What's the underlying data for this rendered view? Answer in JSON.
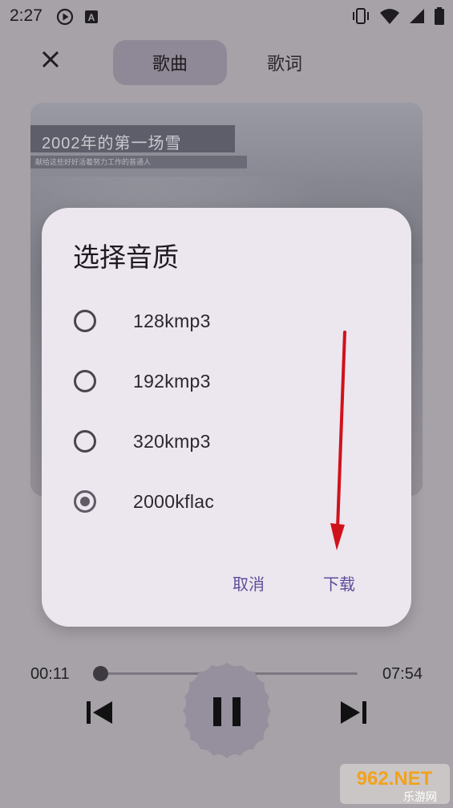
{
  "status_bar": {
    "time": "2:27",
    "left_icons": [
      "play-circle-icon",
      "text-a-icon"
    ],
    "right_icons": [
      "vibrate-icon",
      "wifi-icon",
      "signal-icon",
      "battery-icon"
    ]
  },
  "player": {
    "tabs": [
      {
        "label": "歌曲",
        "selected": true
      },
      {
        "label": "歌词",
        "selected": false
      }
    ],
    "album_art": {
      "title_text": "2002年的第一场雪",
      "subtitle_text": "献给这些好好活着努力工作的普通人"
    },
    "time_current": "00:11",
    "time_total": "07:54",
    "progress": 0.0232,
    "state": "playing"
  },
  "dialog": {
    "title": "选择音质",
    "options": [
      {
        "label": "128kmp3",
        "selected": false
      },
      {
        "label": "192kmp3",
        "selected": false
      },
      {
        "label": "320kmp3",
        "selected": false
      },
      {
        "label": "2000kflac",
        "selected": true
      }
    ],
    "cancel_label": "取消",
    "download_label": "下载"
  },
  "watermark": {
    "brand": "962.NET",
    "site": "乐游网"
  },
  "colors": {
    "accent": "#5e4e9a",
    "dialog_bg": "#ece6ee",
    "arrow": "#d0121b",
    "tab_selected_bg": "#8f8896"
  }
}
